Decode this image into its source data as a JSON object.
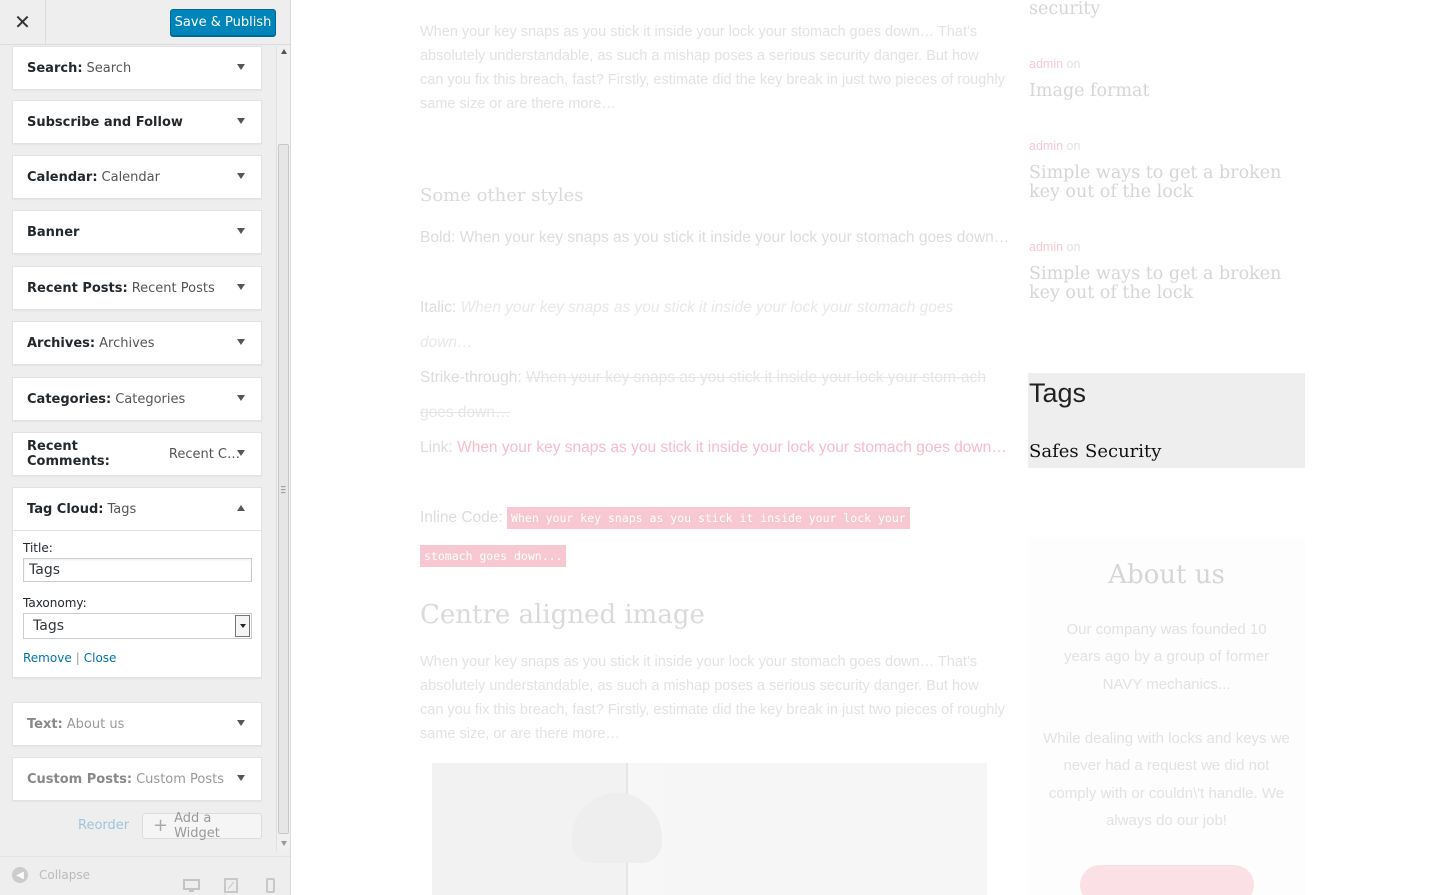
{
  "header": {
    "close_glyph": "✕",
    "publish_label": "Save & Publish"
  },
  "widgets": [
    {
      "name": "Search:",
      "title": "Search",
      "state": "collapsed"
    },
    {
      "name": "Subscribe and Follow",
      "title": "",
      "state": "collapsed"
    },
    {
      "name": "Calendar:",
      "title": "Calendar",
      "state": "collapsed"
    },
    {
      "name": "Banner",
      "title": "",
      "state": "collapsed"
    },
    {
      "name": "Recent Posts:",
      "title": "Recent Posts",
      "state": "collapsed"
    },
    {
      "name": "Archives:",
      "title": "Archives",
      "state": "collapsed"
    },
    {
      "name": "Categories:",
      "title": "Categories",
      "state": "collapsed"
    },
    {
      "name": "Recent Comments:",
      "title": "Recent Co...",
      "state": "collapsed"
    },
    {
      "name": "Tag Cloud:",
      "title": "Tags",
      "state": "expanded"
    },
    {
      "name": "Text:",
      "title": "About us",
      "state": "collapsed"
    },
    {
      "name": "Custom Posts:",
      "title": "Custom Posts",
      "state": "collapsed"
    }
  ],
  "tag_cloud_form": {
    "title_label": "Title:",
    "title_value": "Tags",
    "taxonomy_label": "Taxonomy:",
    "taxonomy_value": "Tags",
    "remove_label": "Remove",
    "separator": "|",
    "close_label": "Close"
  },
  "actions": {
    "reorder_label": "Reorder",
    "add_widget_label": "Add a Widget"
  },
  "footer": {
    "collapse_label": "Collapse"
  },
  "preview": {
    "para1": "When your key snaps as you stick it inside your lock your stomach goes down… That’s absolutely understandable, as such a mishap poses a serious security danger. But how can you fix this breach, fast? Firstly, estimate did the key break in just two pieces of roughly same size or are there more…",
    "other_styles_heading": "Some other styles",
    "bold_label": "Bold:",
    "bold_text": "When your key snaps as you stick it inside your lock your stomach goes down…",
    "italic_label": "Italic:",
    "italic_text": "When your key snaps as you stick it inside your lock your stomach goes down…",
    "strike_label": "Strike-through:",
    "strike_text": "When your key snaps as you stick it inside your lock your stom-ach goes down…",
    "link_label": "Link:",
    "link_text": "When your key snaps as you stick it inside your lock your stomach goes down…",
    "code_label": "Inline Code:",
    "code_text_1": "When your key snaps as you stick it inside your lock your",
    "code_text_2": "stomach goes down...",
    "centre_heading": "Centre aligned image",
    "para2": "When your key snaps as you stick it inside your lock your stomach goes down… That’s absolutely understandable, as such a mishap poses a serious security danger. But how can you fix this breach, fast? Firstly, estimate did the key break in just two pieces of roughly same size, or are there more…"
  },
  "recent_sidebar": {
    "top_title": "security",
    "items": [
      {
        "author": "admin",
        "on": "on",
        "title": "Image format"
      },
      {
        "author": "admin",
        "on": "on",
        "title": "Simple ways to get a broken key out of the lock"
      },
      {
        "author": "admin",
        "on": "on",
        "title": "Simple ways to get a broken key out of the lock"
      }
    ]
  },
  "tags_widget": {
    "title": "Tags",
    "tags": [
      "Safes",
      "Security"
    ]
  },
  "about_widget": {
    "title": "About us",
    "para1": "Our company was founded 10 years ago by a group of former NAVY mechanics...",
    "para2": "While dealing with locks and keys we never had a request we did not comply with or couldn\\'t handle. We always do our job!"
  },
  "colors": {
    "publish_button": "#0085ba",
    "link_blue": "#0073aa",
    "sidebar_bg": "#eeeeee",
    "accent_pink": "#f7bcc9"
  }
}
